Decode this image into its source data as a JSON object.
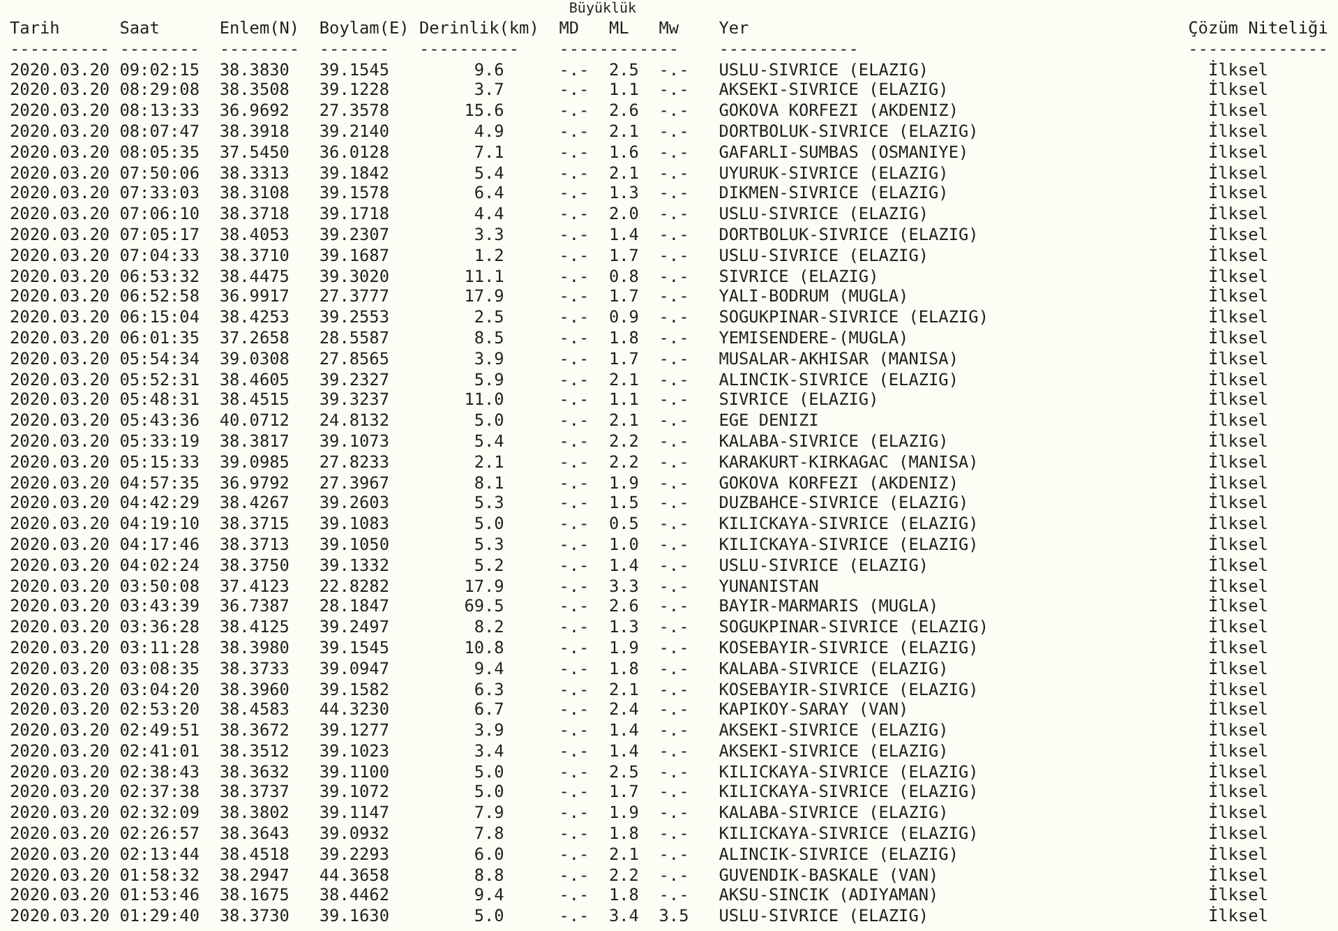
{
  "magnitude_group": {
    "title": "Büyüklük",
    "rule": "------------"
  },
  "columns": [
    {
      "label": "Tarih",
      "rule": "----------"
    },
    {
      "label": "Saat",
      "rule": "--------"
    },
    {
      "label": "Enlem(N)",
      "rule": "--------"
    },
    {
      "label": "Boylam(E)",
      "rule": "-------"
    },
    {
      "label": "Derinlik(km)",
      "rule": "----------"
    },
    {
      "label": "MD"
    },
    {
      "label": "ML"
    },
    {
      "label": "Mw"
    },
    {
      "label": "Yer",
      "rule": "--------------"
    },
    {
      "label": "Çözüm Niteliği",
      "rule": "--------------"
    }
  ],
  "rows": [
    {
      "cells": [
        "2020.03.20",
        "09:02:15",
        "38.3830",
        "39.1545",
        "9.6",
        "-.-",
        "2.5",
        "-.-",
        "USLU-SIVRICE (ELAZIG)",
        "İlksel"
      ]
    },
    {
      "cells": [
        "2020.03.20",
        "08:29:08",
        "38.3508",
        "39.1228",
        "3.7",
        "-.-",
        "1.1",
        "-.-",
        "AKSEKI-SIVRICE (ELAZIG)",
        "İlksel"
      ]
    },
    {
      "cells": [
        "2020.03.20",
        "08:13:33",
        "36.9692",
        "27.3578",
        "15.6",
        "-.-",
        "2.6",
        "-.-",
        "GOKOVA KORFEZI (AKDENIZ)",
        "İlksel"
      ]
    },
    {
      "cells": [
        "2020.03.20",
        "08:07:47",
        "38.3918",
        "39.2140",
        "4.9",
        "-.-",
        "2.1",
        "-.-",
        "DORTBOLUK-SIVRICE (ELAZIG)",
        "İlksel"
      ]
    },
    {
      "cells": [
        "2020.03.20",
        "08:05:35",
        "37.5450",
        "36.0128",
        "7.1",
        "-.-",
        "1.6",
        "-.-",
        "GAFARLI-SUMBAS (OSMANIYE)",
        "İlksel"
      ]
    },
    {
      "cells": [
        "2020.03.20",
        "07:50:06",
        "38.3313",
        "39.1842",
        "5.4",
        "-.-",
        "2.1",
        "-.-",
        "UYURUK-SIVRICE (ELAZIG)",
        "İlksel"
      ]
    },
    {
      "cells": [
        "2020.03.20",
        "07:33:03",
        "38.3108",
        "39.1578",
        "6.4",
        "-.-",
        "1.3",
        "-.-",
        "DIKMEN-SIVRICE (ELAZIG)",
        "İlksel"
      ]
    },
    {
      "cells": [
        "2020.03.20",
        "07:06:10",
        "38.3718",
        "39.1718",
        "4.4",
        "-.-",
        "2.0",
        "-.-",
        "USLU-SIVRICE (ELAZIG)",
        "İlksel"
      ]
    },
    {
      "cells": [
        "2020.03.20",
        "07:05:17",
        "38.4053",
        "39.2307",
        "3.3",
        "-.-",
        "1.4",
        "-.-",
        "DORTBOLUK-SIVRICE (ELAZIG)",
        "İlksel"
      ]
    },
    {
      "cells": [
        "2020.03.20",
        "07:04:33",
        "38.3710",
        "39.1687",
        "1.2",
        "-.-",
        "1.7",
        "-.-",
        "USLU-SIVRICE (ELAZIG)",
        "İlksel"
      ]
    },
    {
      "cells": [
        "2020.03.20",
        "06:53:32",
        "38.4475",
        "39.3020",
        "11.1",
        "-.-",
        "0.8",
        "-.-",
        "SIVRICE (ELAZIG)",
        "İlksel"
      ]
    },
    {
      "cells": [
        "2020.03.20",
        "06:52:58",
        "36.9917",
        "27.3777",
        "17.9",
        "-.-",
        "1.7",
        "-.-",
        "YALI-BODRUM (MUGLA)",
        "İlksel"
      ]
    },
    {
      "cells": [
        "2020.03.20",
        "06:15:04",
        "38.4253",
        "39.2553",
        "2.5",
        "-.-",
        "0.9",
        "-.-",
        "SOGUKPINAR-SIVRICE (ELAZIG)",
        "İlksel"
      ]
    },
    {
      "cells": [
        "2020.03.20",
        "06:01:35",
        "37.2658",
        "28.5587",
        "8.5",
        "-.-",
        "1.8",
        "-.-",
        "YEMISENDERE-(MUGLA)",
        "İlksel"
      ]
    },
    {
      "cells": [
        "2020.03.20",
        "05:54:34",
        "39.0308",
        "27.8565",
        "3.9",
        "-.-",
        "1.7",
        "-.-",
        "MUSALAR-AKHISAR (MANISA)",
        "İlksel"
      ]
    },
    {
      "cells": [
        "2020.03.20",
        "05:52:31",
        "38.4605",
        "39.2327",
        "5.9",
        "-.-",
        "2.1",
        "-.-",
        "ALINCIK-SIVRICE (ELAZIG)",
        "İlksel"
      ]
    },
    {
      "cells": [
        "2020.03.20",
        "05:48:31",
        "38.4515",
        "39.3237",
        "11.0",
        "-.-",
        "1.1",
        "-.-",
        "SIVRICE (ELAZIG)",
        "İlksel"
      ]
    },
    {
      "cells": [
        "2020.03.20",
        "05:43:36",
        "40.0712",
        "24.8132",
        "5.0",
        "-.-",
        "2.1",
        "-.-",
        "EGE DENIZI",
        "İlksel"
      ]
    },
    {
      "cells": [
        "2020.03.20",
        "05:33:19",
        "38.3817",
        "39.1073",
        "5.4",
        "-.-",
        "2.2",
        "-.-",
        "KALABA-SIVRICE (ELAZIG)",
        "İlksel"
      ]
    },
    {
      "cells": [
        "2020.03.20",
        "05:15:33",
        "39.0985",
        "27.8233",
        "2.1",
        "-.-",
        "2.2",
        "-.-",
        "KARAKURT-KIRKAGAC (MANISA)",
        "İlksel"
      ]
    },
    {
      "cells": [
        "2020.03.20",
        "04:57:35",
        "36.9792",
        "27.3967",
        "8.1",
        "-.-",
        "1.9",
        "-.-",
        "GOKOVA KORFEZI (AKDENIZ)",
        "İlksel"
      ]
    },
    {
      "cells": [
        "2020.03.20",
        "04:42:29",
        "38.4267",
        "39.2603",
        "5.3",
        "-.-",
        "1.5",
        "-.-",
        "DUZBAHCE-SIVRICE (ELAZIG)",
        "İlksel"
      ]
    },
    {
      "cells": [
        "2020.03.20",
        "04:19:10",
        "38.3715",
        "39.1083",
        "5.0",
        "-.-",
        "0.5",
        "-.-",
        "KILICKAYA-SIVRICE (ELAZIG)",
        "İlksel"
      ]
    },
    {
      "cells": [
        "2020.03.20",
        "04:17:46",
        "38.3713",
        "39.1050",
        "5.3",
        "-.-",
        "1.0",
        "-.-",
        "KILICKAYA-SIVRICE (ELAZIG)",
        "İlksel"
      ]
    },
    {
      "cells": [
        "2020.03.20",
        "04:02:24",
        "38.3750",
        "39.1332",
        "5.2",
        "-.-",
        "1.4",
        "-.-",
        "USLU-SIVRICE (ELAZIG)",
        "İlksel"
      ]
    },
    {
      "cells": [
        "2020.03.20",
        "03:50:08",
        "37.4123",
        "22.8282",
        "17.9",
        "-.-",
        "3.3",
        "-.-",
        "YUNANISTAN",
        "İlksel"
      ]
    },
    {
      "cells": [
        "2020.03.20",
        "03:43:39",
        "36.7387",
        "28.1847",
        "69.5",
        "-.-",
        "2.6",
        "-.-",
        "BAYIR-MARMARIS (MUGLA)",
        "İlksel"
      ]
    },
    {
      "cells": [
        "2020.03.20",
        "03:36:28",
        "38.4125",
        "39.2497",
        "8.2",
        "-.-",
        "1.3",
        "-.-",
        "SOGUKPINAR-SIVRICE (ELAZIG)",
        "İlksel"
      ]
    },
    {
      "cells": [
        "2020.03.20",
        "03:11:28",
        "38.3980",
        "39.1545",
        "10.8",
        "-.-",
        "1.9",
        "-.-",
        "KOSEBAYIR-SIVRICE (ELAZIG)",
        "İlksel"
      ]
    },
    {
      "cells": [
        "2020.03.20",
        "03:08:35",
        "38.3733",
        "39.0947",
        "9.4",
        "-.-",
        "1.8",
        "-.-",
        "KALABA-SIVRICE (ELAZIG)",
        "İlksel"
      ]
    },
    {
      "cells": [
        "2020.03.20",
        "03:04:20",
        "38.3960",
        "39.1582",
        "6.3",
        "-.-",
        "2.1",
        "-.-",
        "KOSEBAYIR-SIVRICE (ELAZIG)",
        "İlksel"
      ]
    },
    {
      "cells": [
        "2020.03.20",
        "02:53:20",
        "38.4583",
        "44.3230",
        "6.7",
        "-.-",
        "2.4",
        "-.-",
        "KAPIKOY-SARAY (VAN)",
        "İlksel"
      ]
    },
    {
      "cells": [
        "2020.03.20",
        "02:49:51",
        "38.3672",
        "39.1277",
        "3.9",
        "-.-",
        "1.4",
        "-.-",
        "AKSEKI-SIVRICE (ELAZIG)",
        "İlksel"
      ]
    },
    {
      "cells": [
        "2020.03.20",
        "02:41:01",
        "38.3512",
        "39.1023",
        "3.4",
        "-.-",
        "1.4",
        "-.-",
        "AKSEKI-SIVRICE (ELAZIG)",
        "İlksel"
      ]
    },
    {
      "cells": [
        "2020.03.20",
        "02:38:43",
        "38.3632",
        "39.1100",
        "5.0",
        "-.-",
        "2.5",
        "-.-",
        "KILICKAYA-SIVRICE (ELAZIG)",
        "İlksel"
      ]
    },
    {
      "cells": [
        "2020.03.20",
        "02:37:38",
        "38.3737",
        "39.1072",
        "5.0",
        "-.-",
        "1.7",
        "-.-",
        "KILICKAYA-SIVRICE (ELAZIG)",
        "İlksel"
      ]
    },
    {
      "cells": [
        "2020.03.20",
        "02:32:09",
        "38.3802",
        "39.1147",
        "7.9",
        "-.-",
        "1.9",
        "-.-",
        "KALABA-SIVRICE (ELAZIG)",
        "İlksel"
      ]
    },
    {
      "cells": [
        "2020.03.20",
        "02:26:57",
        "38.3643",
        "39.0932",
        "7.8",
        "-.-",
        "1.8",
        "-.-",
        "KILICKAYA-SIVRICE (ELAZIG)",
        "İlksel"
      ]
    },
    {
      "cells": [
        "2020.03.20",
        "02:13:44",
        "38.4518",
        "39.2293",
        "6.0",
        "-.-",
        "2.1",
        "-.-",
        "ALINCIK-SIVRICE (ELAZIG)",
        "İlksel"
      ]
    },
    {
      "cells": [
        "2020.03.20",
        "01:58:32",
        "38.2947",
        "44.3658",
        "8.8",
        "-.-",
        "2.2",
        "-.-",
        "GUVENDIK-BASKALE (VAN)",
        "İlksel"
      ]
    },
    {
      "cells": [
        "2020.03.20",
        "01:53:46",
        "38.1675",
        "38.4462",
        "9.4",
        "-.-",
        "1.8",
        "-.-",
        "AKSU-SINCIK (ADIYAMAN)",
        "İlksel"
      ]
    },
    {
      "cells": [
        "2020.03.20",
        "01:29:40",
        "38.3730",
        "39.1630",
        "5.0",
        "-.-",
        "3.4",
        "3.5",
        "USLU-SIVRICE (ELAZIG)",
        "İlksel"
      ]
    }
  ]
}
